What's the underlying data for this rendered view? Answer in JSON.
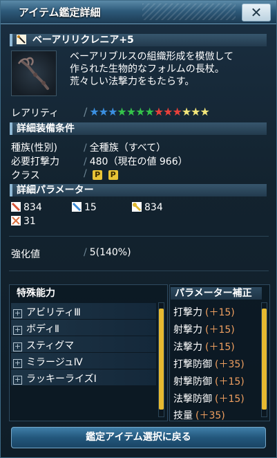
{
  "window": {
    "title": "アイテム鑑定詳細",
    "close_label": "✕"
  },
  "item": {
    "name": "ベーアリリクレニア+5",
    "description_lines": [
      "ベーアリブルスの組織形成を模倣して",
      "作られた生物的なフォルムの長杖。",
      "荒々しい法撃力をもたらす。"
    ]
  },
  "rarity": {
    "label": "レアリティ",
    "stars": 13,
    "star_colors": [
      "#3b8fe0",
      "#3b8fe0",
      "#3b8fe0",
      "#34c24a",
      "#34c24a",
      "#34c24a",
      "#34c24a",
      "#e8403a",
      "#e8403a",
      "#e8403a",
      "#f2e67a",
      "#f2e67a",
      "#f2e67a"
    ]
  },
  "requirements": {
    "header": "詳細装備条件",
    "rows": [
      {
        "label": "種族(性別)",
        "value": "全種族（すべて）"
      },
      {
        "label": "必要打撃力",
        "value": "480（現在の値 966）"
      },
      {
        "label": "クラス",
        "value": ""
      }
    ],
    "class_badges": [
      "P",
      "P"
    ]
  },
  "parameters": {
    "header": "詳細パラメーター",
    "stats": [
      {
        "icon": "melee-attack-icon",
        "value": "834",
        "color": "#d8553a"
      },
      {
        "icon": "ranged-attack-icon",
        "value": "15",
        "color": "#3a8ad8"
      },
      {
        "icon": "tech-attack-icon",
        "value": "834",
        "color": "#e0b830"
      },
      {
        "icon": "dexterity-icon",
        "value": "31",
        "color": "#d87040"
      }
    ]
  },
  "enhance": {
    "label": "強化値",
    "value": "5(140%)"
  },
  "abilities": {
    "header": "特殊能力",
    "items": [
      "アビリティⅢ",
      "ボディⅡ",
      "スティグマ",
      "ミラージュⅣ",
      "ラッキーライズⅠ"
    ]
  },
  "corrections": {
    "header": "パラメーター補正",
    "items": [
      {
        "label": "打撃力",
        "bonus": "(＋15)"
      },
      {
        "label": "射撃力",
        "bonus": "(＋15)"
      },
      {
        "label": "法撃力",
        "bonus": "(＋15)"
      },
      {
        "label": "打撃防御",
        "bonus": "(＋35)"
      },
      {
        "label": "射撃防御",
        "bonus": "(＋15)"
      },
      {
        "label": "法撃防御",
        "bonus": "(＋15)"
      },
      {
        "label": "技量",
        "bonus": "(＋35)"
      }
    ]
  },
  "footer": {
    "back_label": "鑑定アイテム選択に戻る"
  }
}
